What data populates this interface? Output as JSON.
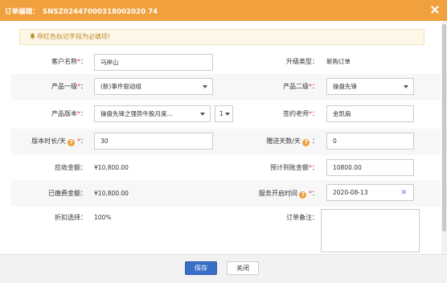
{
  "dialog": {
    "title_prefix": "订单编辑：",
    "order_number": "SNSZ02447000318002020 74"
  },
  "notice": "带红色标记字段为必填项!",
  "fields": {
    "customer_name": {
      "label": "客户名称",
      "value": "马岸山"
    },
    "upgrade_type": {
      "label": "升级类型：",
      "value": "新购订单"
    },
    "product_level1": {
      "label": "产品一级",
      "value": "(新)事件驱动组"
    },
    "product_level2": {
      "label": "产品二级",
      "value": "操盘先锋"
    },
    "product_version": {
      "label": "产品版本",
      "value": "操盘先锋之强势牛股月度…",
      "qty": "1"
    },
    "signing_teacher": {
      "label": "签约老师",
      "value": "金凯扇"
    },
    "version_duration": {
      "label": "版本时长/天",
      "value": "30"
    },
    "gift_days": {
      "label": "赠送天数/天",
      "value": "0"
    },
    "receivable_amount": {
      "label": "应收金额：",
      "value": "¥10,800.00"
    },
    "expected_arrival_amount": {
      "label": "预计到账金额",
      "value": "10800.00"
    },
    "paid_amount": {
      "label": "已缴费金额：",
      "value": "¥10,800.00"
    },
    "service_start_time": {
      "label": "服务开启时间",
      "value": "2020-08-13"
    },
    "discount": {
      "label": "折扣选择：",
      "value": "100%"
    },
    "order_remark": {
      "label": "订单备注：",
      "value": ""
    }
  },
  "footer": {
    "save_label": "保存",
    "close_label": "关闭"
  },
  "colors": {
    "titlebar": "#f0a03c",
    "primary_button": "#3a6fc7",
    "required": "#e33333",
    "notice_text": "#c08a2a"
  }
}
